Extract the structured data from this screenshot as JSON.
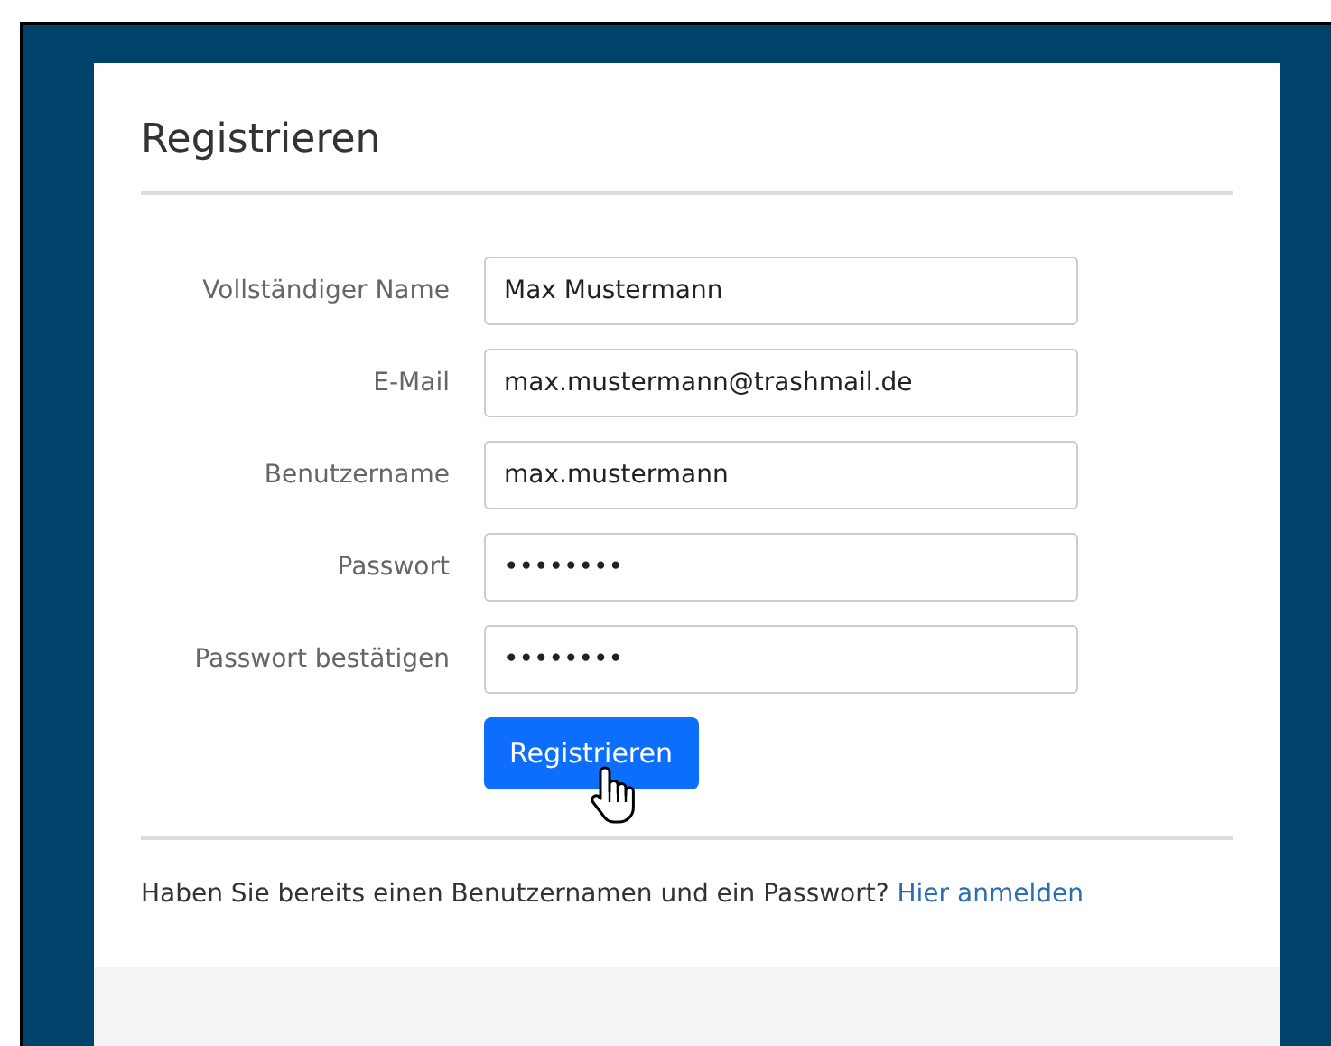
{
  "title": "Registrieren",
  "fields": [
    {
      "label": "Vollständiger Name",
      "value": "Max Mustermann"
    },
    {
      "label": "E-Mail",
      "value": "max.mustermann@trashmail.de"
    },
    {
      "label": "Benutzername",
      "value": "max.mustermann"
    },
    {
      "label": "Passwort",
      "value": "••••••••"
    },
    {
      "label": "Passwort bestätigen",
      "value": "••••••••"
    }
  ],
  "submit_button": "Registrieren",
  "footer": {
    "text": "Haben Sie bereits einen Benutzernamen und ein Passwort?",
    "link": "Hier anmelden"
  }
}
